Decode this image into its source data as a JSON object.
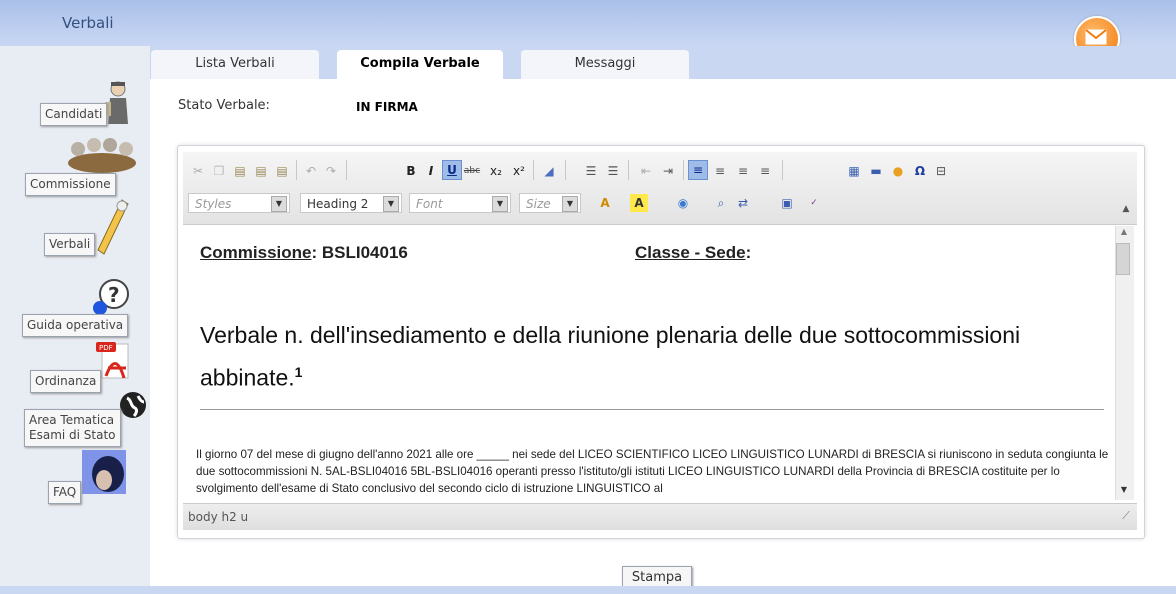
{
  "app": {
    "title": "Verbali"
  },
  "sidebar": {
    "items": [
      {
        "label": "Candidati"
      },
      {
        "label": "Commissione"
      },
      {
        "label": "Verbali"
      },
      {
        "label": "Guida operativa"
      },
      {
        "label": "Ordinanza"
      },
      {
        "label_line1": "Area Tematica",
        "label_line2": "Esami di Stato"
      },
      {
        "label": "FAQ"
      }
    ]
  },
  "tabs": [
    {
      "label": "Lista Verbali",
      "active": false
    },
    {
      "label": "Compila Verbale",
      "active": true
    },
    {
      "label": "Messaggi",
      "active": false
    }
  ],
  "status": {
    "label": "Stato Verbale:",
    "value": "IN FIRMA"
  },
  "editor": {
    "toolbar": {
      "styles_placeholder": "Styles",
      "format_value": "Heading 2",
      "font_placeholder": "Font",
      "size_placeholder": "Size",
      "bold": "B",
      "italic": "I",
      "underline": "U",
      "strike": "abc",
      "subscript": "x₂",
      "superscript": "x²",
      "special_char": "Ω"
    },
    "document": {
      "commission_label": "Commissione",
      "commission_value": ": BSLI04016",
      "class_label": "Classe - Sede",
      "class_suffix": ":",
      "heading": "Verbale n. dell'insediamento e della riunione plenaria delle due sottocommissioni abbinate.",
      "footnote_mark": "1",
      "paragraph": "Il giorno 07 del mese di giugno dell'anno 2021 alle ore _____ nei sede del LICEO SCIENTIFICO LICEO LINGUISTICO LUNARDI di BRESCIA si riuniscono in seduta congiunta le due sottocommissioni N. 5AL-BSLI04016 5BL-BSLI04016 operanti presso l'istituto/gli istituti LICEO LINGUISTICO LUNARDI della Provincia di BRESCIA costituite per lo svolgimento dell'esame di Stato conclusivo del secondo ciclo di istruzione LINGUISTICO al"
    },
    "path": "body  h2  u"
  },
  "actions": {
    "print_label": "Stampa"
  },
  "colors": {
    "header": "#c9d7f3",
    "accent": "#f07b12"
  }
}
